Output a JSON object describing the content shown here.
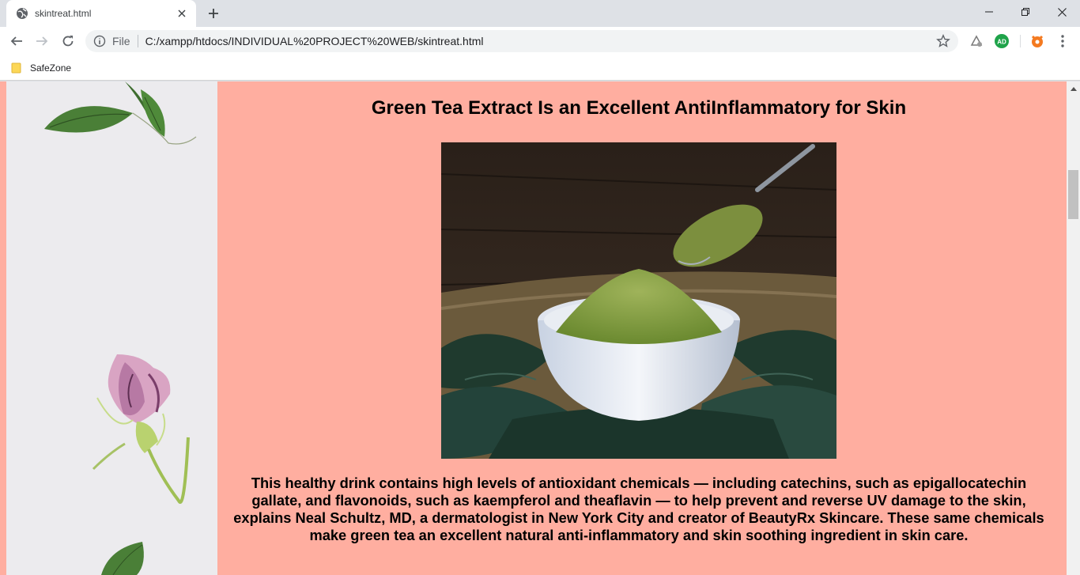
{
  "browser": {
    "tab_title": "skintreat.html",
    "address_scheme": "File",
    "address_url": "C:/xampp/htdocs/INDIVIDUAL%20PROJECT%20WEB/skintreat.html",
    "bookmarks": [
      {
        "label": "SafeZone"
      }
    ],
    "extension_badge": "AD"
  },
  "page": {
    "heading": "Green Tea Extract Is an Excellent AntiInflammatory for Skin",
    "paragraph": "This healthy drink contains high levels of antioxidant chemicals — including catechins, such as epigallocatechin gallate, and flavonoids, such as kaempferol and theaflavin — to help prevent and reverse UV damage to the skin, explains Neal Schultz, MD, a dermatologist in New York City and creator of BeautyRx Skincare. These same chemicals make green tea an excellent natural anti-inflammatory and skin soothing ingredient in skin care.",
    "background_color": "#ffaea0"
  }
}
